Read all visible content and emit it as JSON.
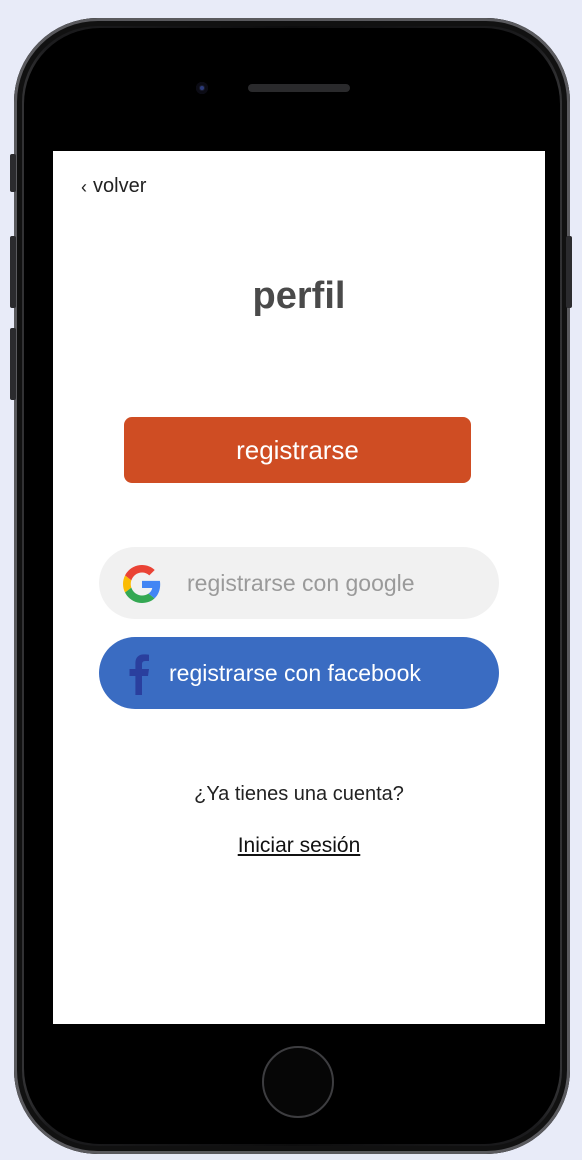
{
  "nav": {
    "back_label": "volver",
    "back_icon": "chevron-left-icon"
  },
  "page": {
    "title": "perfil"
  },
  "actions": {
    "register_label": "registrarse",
    "google_label": "registrarse con google",
    "google_icon": "google-icon",
    "facebook_label": "registrarse con facebook",
    "facebook_icon": "facebook-icon"
  },
  "login": {
    "question": "¿Ya tienes una cuenta?",
    "link_label": "Iniciar sesión"
  },
  "colors": {
    "register_button": "#cf4d23",
    "google_button": "#f1f1f1",
    "facebook_button": "#3a6cc2",
    "title_text": "#4a4a4a"
  }
}
